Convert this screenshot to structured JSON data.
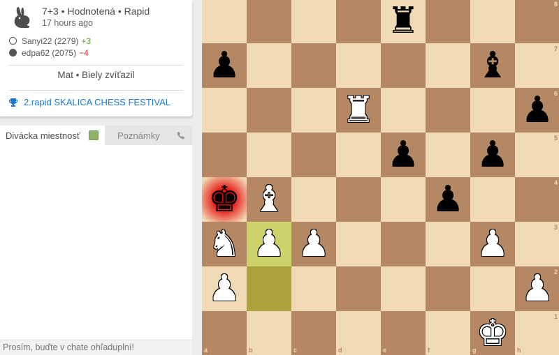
{
  "game": {
    "title": "7+3 • Hodnotená • Rapid",
    "time_ago": "17 hours ago",
    "players": [
      {
        "name": "Sanyi22 (2279)",
        "diff": "+3",
        "color": "white"
      },
      {
        "name": "edpa62 (2075)",
        "diff": "−4",
        "color": "black"
      }
    ],
    "result": "Mat • Biely zvíťazil",
    "tournament": "2.rapid SKALICA CHESS FESTIVAL"
  },
  "tabs": {
    "chat": "Divácka miestnosť",
    "notes": "Poznámky"
  },
  "chat": {
    "placeholder": "Prosím, buďte v chate ohľaduplní!"
  },
  "board": {
    "files": [
      "a",
      "b",
      "c",
      "d",
      "e",
      "f",
      "g",
      "h"
    ],
    "ranks": [
      "8",
      "7",
      "6",
      "5",
      "4",
      "3",
      "2",
      "1"
    ],
    "rows": [
      [
        "",
        "",
        "",
        "",
        "♜",
        "",
        "",
        ""
      ],
      [
        "♟",
        "",
        "",
        "",
        "",
        "",
        "♝",
        ""
      ],
      [
        "",
        "",
        "",
        "♖",
        "",
        "",
        "",
        "♟"
      ],
      [
        "",
        "",
        "",
        "",
        "♟",
        "",
        "♟",
        ""
      ],
      [
        "♚",
        "♗",
        "",
        "",
        "",
        "♟",
        "",
        ""
      ],
      [
        "♘",
        "♙",
        "♙",
        "",
        "",
        "",
        "♙",
        ""
      ],
      [
        "♙",
        "",
        "",
        "",
        "",
        "",
        "",
        "♙"
      ],
      [
        "",
        "",
        "",
        "",
        "",
        "",
        "♔",
        ""
      ]
    ],
    "last_move": [
      "b3",
      "b2"
    ],
    "check": "a4",
    "colors": {
      "light": "#f0d9b5",
      "dark": "#b58863",
      "highlight_light": "#cdd26a",
      "highlight_dark": "#aaa23a",
      "link": "#1b78d0",
      "positive": "#629924",
      "negative": "#cc3333"
    }
  }
}
